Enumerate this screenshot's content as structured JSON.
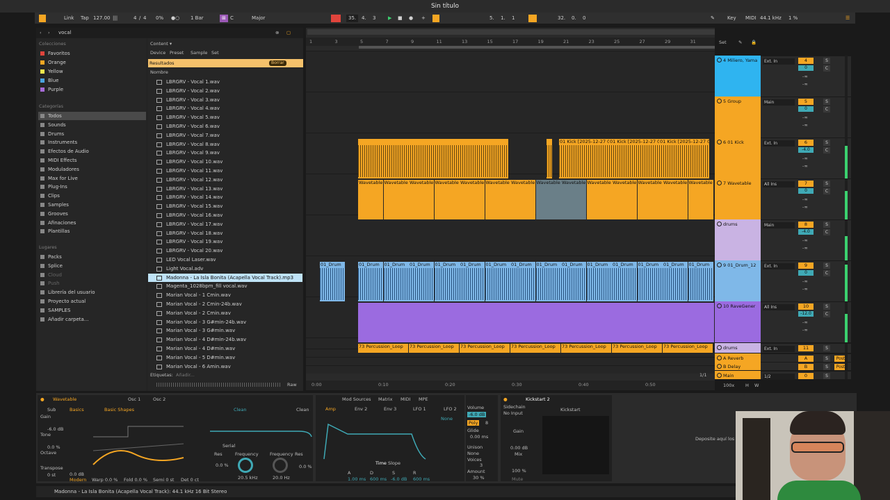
{
  "app": {
    "title": "Sin título"
  },
  "toolbar": {
    "link": "Link",
    "tap": "Tap",
    "tempo": "127.00",
    "sig_num": "4",
    "sig_den": "4",
    "swing": "0%",
    "quant": "1 Bar",
    "key": "C",
    "scale": "Major",
    "pos_bars": "35.",
    "pos_beats": "4.",
    "pos_six": "3",
    "loop_start": "5.",
    "loop_b": "1.",
    "loop_c": "1",
    "loop_len": "32.",
    "loop_len_b": "0.",
    "loop_len_c": "0",
    "key_btn": "Key",
    "midi_btn": "MIDI",
    "sample_rate": "44.1 kHz",
    "cpu": "1 %"
  },
  "browser": {
    "search": "vocal",
    "content_label": "Content ▾",
    "filters": [
      "Device",
      "Preset",
      "Sample",
      "Set"
    ],
    "results": "Resultados",
    "clear": "Borrar",
    "name_col": "Nombre",
    "tags": "Etiquetas:",
    "tags_add": "Añadir...",
    "raw": "Raw"
  },
  "sidebar": {
    "colecciones": "Colecciones",
    "collections": [
      {
        "label": "Favoritos",
        "color": "#e0443c"
      },
      {
        "label": "Orange",
        "color": "#f5a623"
      },
      {
        "label": "Yellow",
        "color": "#f2e94e"
      },
      {
        "label": "Blue",
        "color": "#4aa3df"
      },
      {
        "label": "Purple",
        "color": "#a66bd6"
      }
    ],
    "categorias": "Categorías",
    "categories": [
      "Todos",
      "Sounds",
      "Drums",
      "Instruments",
      "Efectos de Audio",
      "MIDI Effects",
      "Moduladores",
      "Max for Live",
      "Plug-Ins",
      "Clips",
      "Samples",
      "Grooves",
      "Afinaciones",
      "Plantillas"
    ],
    "lugares": "Lugares",
    "places": [
      "Packs",
      "Splice",
      "Cloud",
      "Push",
      "Librería del usuario",
      "Proyecto actual",
      "SAMPLES",
      "Añadir carpeta..."
    ]
  },
  "files": [
    "LBRGRV - Vocal 1.wav",
    "LBRGRV - Vocal 2.wav",
    "LBRGRV - Vocal 3.wav",
    "LBRGRV - Vocal 4.wav",
    "LBRGRV - Vocal 5.wav",
    "LBRGRV - Vocal 6.wav",
    "LBRGRV - Vocal 7.wav",
    "LBRGRV - Vocal 8.wav",
    "LBRGRV - Vocal 9.wav",
    "LBRGRV - Vocal 10.wav",
    "LBRGRV - Vocal 11.wav",
    "LBRGRV - Vocal 12.wav",
    "LBRGRV - Vocal 13.wav",
    "LBRGRV - Vocal 14.wav",
    "LBRGRV - Vocal 15.wav",
    "LBRGRV - Vocal 16.wav",
    "LBRGRV - Vocal 17.wav",
    "LBRGRV - Vocal 18.wav",
    "LBRGRV - Vocal 19.wav",
    "LBRGRV - Vocal 20.wav",
    "LED Vocal Laser.wav",
    "Light Vocal.adv",
    "Madonna - La Isla Bonita (Acapella Vocal Track).mp3",
    "Magenta_1028bpm_fill vocal.wav",
    "Marian Vocal - 1 Cmin.wav",
    "Marian Vocal - 2 Cmin-24b.wav",
    "Marian Vocal - 2 Cmin.wav",
    "Marian Vocal - 3 G#min-24b.wav",
    "Marian Vocal - 3 G#min.wav",
    "Marian Vocal - 4 D#min-24b.wav",
    "Marian Vocal - 4 D#min.wav",
    "Marian Vocal - 5 D#min.wav",
    "Marian Vocal - 6 Amin.wav"
  ],
  "ruler": [
    "1",
    "3",
    "5",
    "7",
    "9",
    "11",
    "13",
    "15",
    "17",
    "19",
    "21",
    "23",
    "25",
    "27",
    "29",
    "31"
  ],
  "time_ruler": [
    "0:00",
    "0:10",
    "0:20",
    "0:30",
    "0:40",
    "0:50"
  ],
  "arrangement": {
    "kick_clip": "01 Kick [2025-12-27 0",
    "wavetable_clip": "Wavetable",
    "drum_clip": "01_Drum",
    "perc_clip": "73 Percussion_Loop",
    "page": "1/1",
    "set_label": "Set"
  },
  "tracks": [
    {
      "name": "4 Miliero, Yama",
      "color": "#2fb4f0",
      "io": "Ext. In",
      "num": "4",
      "vol": "0"
    },
    {
      "name": "5 Group",
      "color": "#f5a623",
      "io": "Main",
      "num": "5",
      "vol": "0"
    },
    {
      "name": "6 01 Kick",
      "color": "#f5a623",
      "io": "Ext. In",
      "num": "6",
      "vol": "-4.0"
    },
    {
      "name": "7 Wavetable",
      "color": "#f5a623",
      "io": "All Ins",
      "num": "7",
      "vol": "0"
    },
    {
      "name": "drums",
      "color": "#c9b3e3",
      "io": "Main",
      "num": "8",
      "vol": "-4.0"
    },
    {
      "name": "9 01_Drum_12",
      "color": "#7fb8e8",
      "io": "Ext. In",
      "num": "9",
      "vol": "0"
    },
    {
      "name": "10 RaveGener",
      "color": "#9b6be0",
      "io": "All Ins",
      "num": "10",
      "vol": "-12.0"
    },
    {
      "name": "drums",
      "color": "#c9b3e3",
      "io": "Ext. In",
      "num": "11",
      "vol": ""
    },
    {
      "name": "A Reverb",
      "color": "#f5a623",
      "io": "",
      "num": "A",
      "vol": ""
    },
    {
      "name": "B Delay",
      "color": "#f5a623",
      "io": "",
      "num": "B",
      "vol": ""
    },
    {
      "name": "Main",
      "color": "#f5a623",
      "io": "1/2",
      "num": "0",
      "vol": "-6.0"
    }
  ],
  "mixer": {
    "solo": "S",
    "mute": "C",
    "post": "Post",
    "in": "In",
    "auto": "Auto",
    "off": "Off",
    "sub_group": "5-Group",
    "drums_out": "drums",
    "all_channels": "All Channe",
    "minus_inf": "-∞",
    "zoom": "100x",
    "h": "H",
    "w": "W"
  },
  "device": {
    "name": "Wavetable",
    "osc1": "Osc 1",
    "osc2": "Osc 2",
    "sub": "Sub",
    "gain": "Gain",
    "gain_val": "-6.0 dB",
    "tone": "Tone",
    "tone_val": "0.0 %",
    "octave": "Octave",
    "transpose": "Transpose",
    "transpose_val": "0 st",
    "basics": "Basics",
    "basic_shapes": "Basic Shapes",
    "modern": "Modern",
    "warp": "Warp 0.0 %",
    "fold": "Fold 0.0 %",
    "semi": "Semi 0 st",
    "det": "Det 0 ct",
    "db": "0.0 dB",
    "clean": "Clean",
    "serial": "Serial",
    "res": "Res",
    "res_val": "0.0 %",
    "frequency": "Frequency",
    "freq_val": "20.5 kHz",
    "freq2": "Frequency",
    "freq2_val": "20.0 Hz",
    "res2": "Res",
    "res2_val": "0.0 %",
    "mod_sources": "Mod Sources",
    "matrix": "Matrix",
    "midi": "MIDI",
    "mpe": "MPE",
    "amp": "Amp",
    "env2": "Env 2",
    "env3": "Env 3",
    "lfo1": "LFO 1",
    "lfo2": "LFO 2",
    "none": "None",
    "time": "Time",
    "slope": "Slope",
    "a": "A",
    "d": "D",
    "s": "S",
    "r": "R",
    "a_val": "1.00 ms",
    "d_val": "600 ms",
    "s_val": "-6.0 dB",
    "r_val": "600 ms",
    "volume": "Volume",
    "volume_val": "-6.0 dB",
    "poly": "Poly",
    "poly_n": "8",
    "glide": "Glide",
    "glide_val": "0.00 ms",
    "unison": "Unison",
    "unison_val": "None",
    "voices": "Voices",
    "voices_val": "3",
    "amount": "Amount",
    "amount_val": "30 %",
    "kickstart": "Kickstart 2",
    "kickstart_b": "Kickstart",
    "sidechain": "Sidechain",
    "no_input": "No Input",
    "k_gain": "Gain",
    "k_gain_val": "0.00 dB",
    "mix": "Mix",
    "mix_val": "100 %",
    "mute": "Mute",
    "drop": "Deposite aquí los"
  },
  "status": "Madonna - La Isla Bonita (Acapella Vocal Track): 44.1 kHz 16 Bit Stereo"
}
